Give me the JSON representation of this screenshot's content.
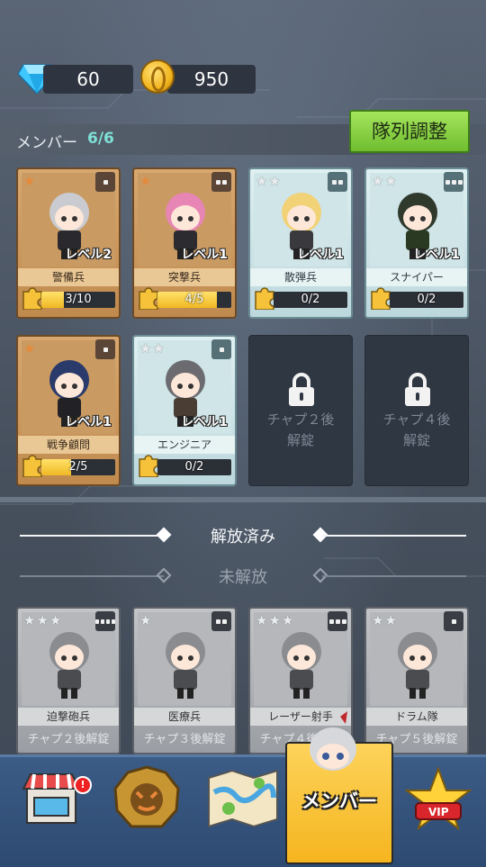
{
  "currency": {
    "gems": "60",
    "coins": "950"
  },
  "header": {
    "member_label": "メンバー",
    "member_count": "6/6",
    "adjust_button": "隊列調整"
  },
  "unlocked_cards": [
    {
      "name": "警備兵",
      "stars": "★",
      "level": "レベル2",
      "progress_text": "3/10",
      "progress": 0.3,
      "rarity": "gold",
      "slot": "square-1"
    },
    {
      "name": "突撃兵",
      "stars": "★",
      "level": "レベル1",
      "progress_text": "4/5",
      "progress": 0.8,
      "rarity": "gold",
      "slot": "square-2"
    },
    {
      "name": "散弾兵",
      "stars": "★★",
      "level": "レベル1",
      "progress_text": "0/2",
      "progress": 0,
      "rarity": "teal",
      "slot": "square-2"
    },
    {
      "name": "スナイパー",
      "stars": "★★",
      "level": "レベル1",
      "progress_text": "0/2",
      "progress": 0,
      "rarity": "teal",
      "slot": "square-3"
    },
    {
      "name": "戦争顧問",
      "stars": "★",
      "level": "レベル1",
      "progress_text": "2/5",
      "progress": 0.4,
      "rarity": "gold",
      "slot": "square-1"
    },
    {
      "name": "エンジニア",
      "stars": "★★",
      "level": "レベル1",
      "progress_text": "0/2",
      "progress": 0,
      "rarity": "teal",
      "slot": "square-1"
    }
  ],
  "locked_slots": [
    {
      "text": "チャプ２後\n解錠"
    },
    {
      "text": "チャプ４後\n解錠"
    }
  ],
  "sections": {
    "released": "解放済み",
    "unreleased": "未解放"
  },
  "unreleased_cards": [
    {
      "name": "迫撃砲兵",
      "stars": "★★★",
      "unlock": "チャプ２後解錠",
      "slot": "square-4"
    },
    {
      "name": "医療兵",
      "stars": "★",
      "unlock": "チャプ３後解錠",
      "slot": "square-2"
    },
    {
      "name": "レーザー射手",
      "stars": "★★★",
      "unlock": "チャプ４後解錠",
      "slot": "square-3"
    },
    {
      "name": "ドラム隊",
      "stars": "★★",
      "unlock": "チャプ５後解錠",
      "slot": "square-1"
    }
  ],
  "nav": {
    "shop_icon": "shop-icon",
    "badge": "!",
    "battle_icon": "battle-emblem-icon",
    "map_icon": "map-icon",
    "members_label": "メンバー",
    "vip_label": "VIP"
  },
  "colors": {
    "gold_card": "#c99a62",
    "teal_card": "#cfe5e8",
    "accent_green": "#8ad447",
    "nav_active": "#f5b51f",
    "count_teal": "#7fe0d4"
  }
}
